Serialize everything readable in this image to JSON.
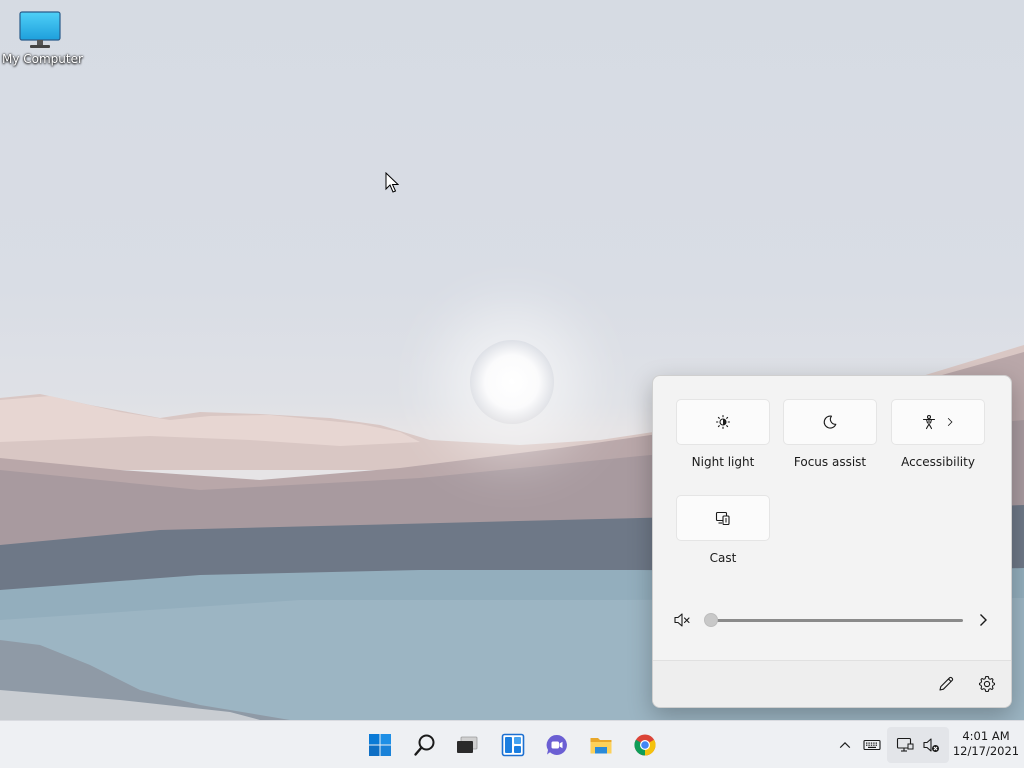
{
  "desktop": {
    "icons": [
      {
        "label": "My Computer",
        "icon": "monitor-icon"
      }
    ]
  },
  "quick_settings": {
    "tiles": [
      {
        "label": "Night light",
        "icon": "brightness-icon",
        "has_chevron": false
      },
      {
        "label": "Focus assist",
        "icon": "moon-icon",
        "has_chevron": false
      },
      {
        "label": "Accessibility",
        "icon": "accessibility-icon",
        "has_chevron": true
      },
      {
        "label": "Cast",
        "icon": "cast-icon",
        "has_chevron": false
      }
    ],
    "volume": {
      "muted": true,
      "level": 0,
      "icon": "speaker-muted-icon"
    },
    "footer": {
      "edit_icon": "pencil-icon",
      "settings_icon": "gear-icon"
    }
  },
  "taskbar": {
    "apps": [
      {
        "name": "start",
        "icon": "windows-logo-icon"
      },
      {
        "name": "search",
        "icon": "search-icon"
      },
      {
        "name": "task-view",
        "icon": "task-view-icon"
      },
      {
        "name": "widgets",
        "icon": "widgets-icon"
      },
      {
        "name": "chat",
        "icon": "chat-icon"
      },
      {
        "name": "file-explorer",
        "icon": "folder-icon"
      },
      {
        "name": "chrome",
        "icon": "chrome-icon"
      }
    ],
    "tray": {
      "overflow_icon": "chevron-up-icon",
      "keyboard_icon": "keyboard-icon",
      "network_icon": "network-icon",
      "volume_icon": "speaker-muted-icon"
    },
    "clock": {
      "time": "4:01 AM",
      "date": "12/17/2021"
    }
  },
  "colors": {
    "accent": "#005fb8",
    "taskbar_bg": "#eef0f3",
    "flyout_bg": "#f3f3f3"
  }
}
